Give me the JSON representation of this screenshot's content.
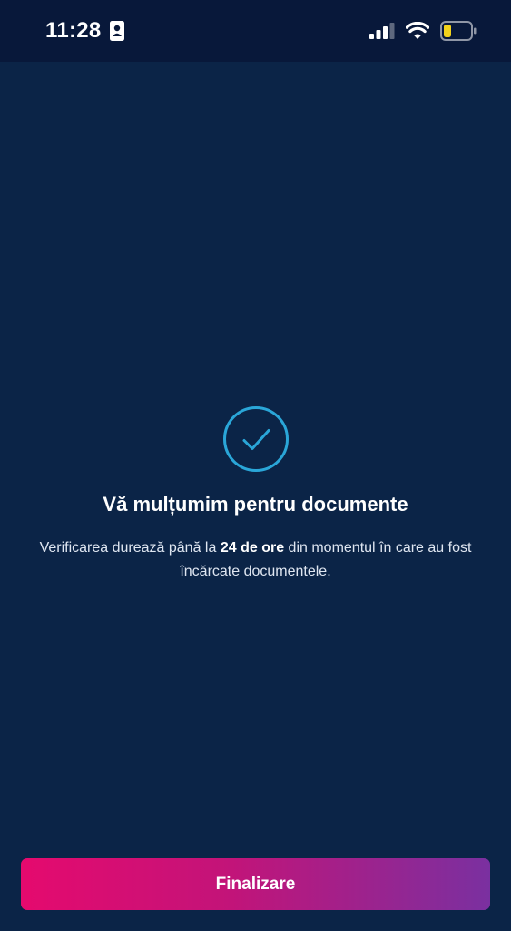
{
  "status_bar": {
    "time": "11:28",
    "icons": [
      "id-card-icon",
      "cellular-signal-icon",
      "wifi-icon",
      "battery-low-icon"
    ]
  },
  "confirmation": {
    "icon": "check-circle-icon",
    "title": "Vă mulțumim pentru documente",
    "message_before": "Verificarea durează până la ",
    "message_bold": "24 de ore",
    "message_after": " din momentul în care au fost încărcate documentele."
  },
  "actions": {
    "finish_label": "Finalizare"
  },
  "colors": {
    "background": "#0b2447",
    "status_bar": "#08183a",
    "accent_check": "#2aa6d8",
    "button_gradient_start": "#e50a6e",
    "button_gradient_end": "#7a30a0",
    "battery_level": "#f2d21b"
  }
}
